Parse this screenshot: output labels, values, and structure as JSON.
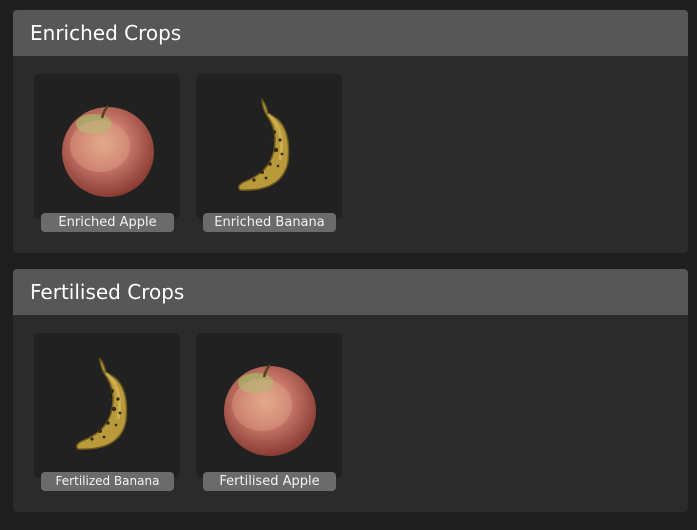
{
  "sections": [
    {
      "title": "Enriched Crops",
      "items": [
        {
          "label": "Enriched Apple",
          "icon": "apple-icon"
        },
        {
          "label": "Enriched Banana",
          "icon": "banana-icon"
        }
      ]
    },
    {
      "title": "Fertilised Crops",
      "items": [
        {
          "label": "Fertilized Banana",
          "icon": "banana-icon"
        },
        {
          "label": "Fertilised Apple",
          "icon": "apple-icon"
        }
      ]
    }
  ],
  "colors": {
    "background": "#1e1e1e",
    "panel": "#2b2b2b",
    "panel_header": "#575757",
    "tile": "#212121",
    "label_chip": "#6b6b6b"
  }
}
